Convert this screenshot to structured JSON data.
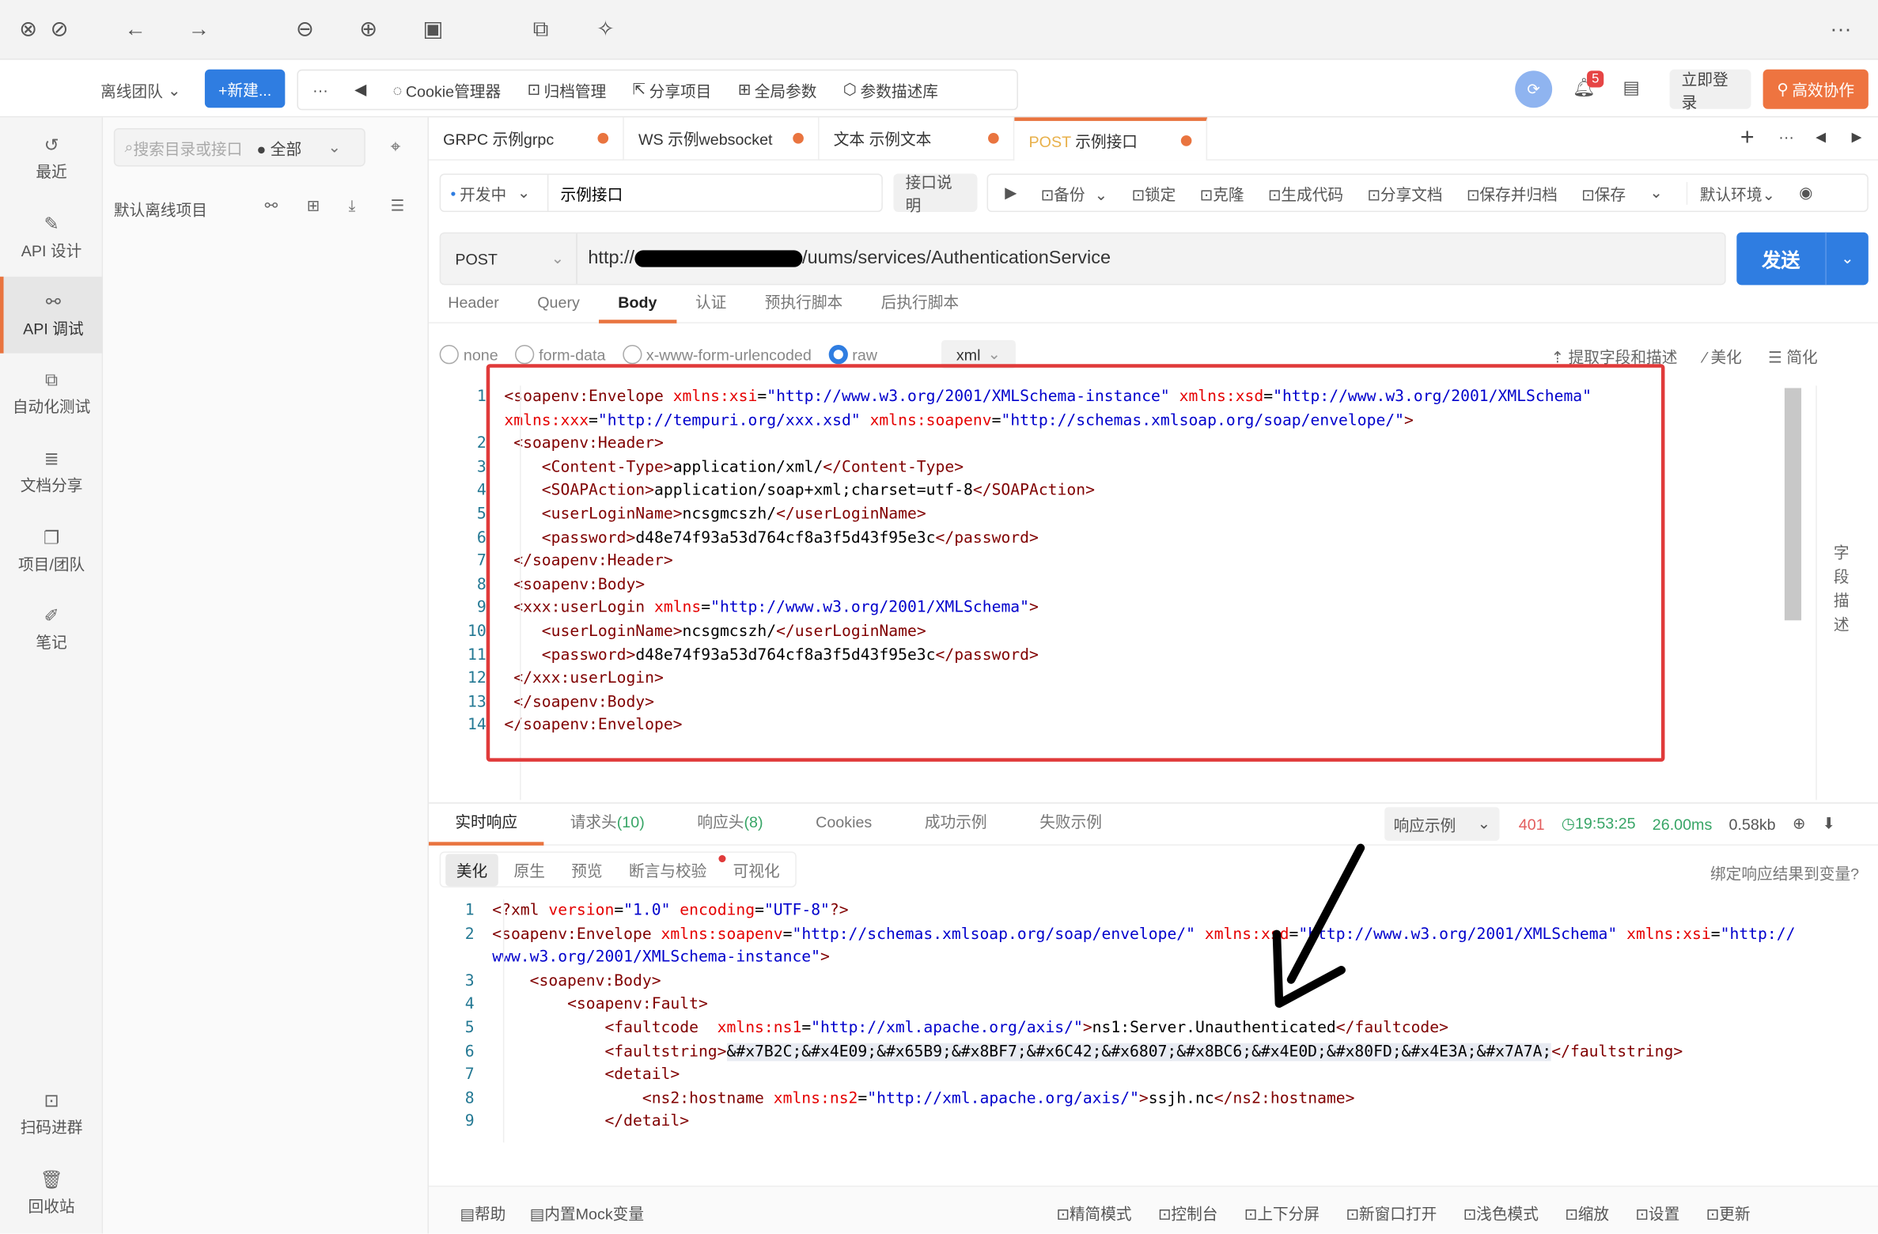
{
  "titlebar": {
    "icons": [
      "close-icon",
      "minimize-icon",
      "back-icon",
      "forward-icon",
      "zoom-out-icon",
      "zoom-in-icon",
      "fit-icon",
      "rotate-icon",
      "magic-icon",
      "more-icon"
    ]
  },
  "topbar": {
    "team": "离线团队",
    "new_btn": "+新建...",
    "more": "···",
    "tools": [
      "Cookie管理器",
      "归档管理",
      "分享项目",
      "全局参数",
      "参数描述库"
    ],
    "badge": "5",
    "login": "立即登录",
    "collab": "高效协作"
  },
  "leftnav": {
    "items": [
      "最近",
      "API 设计",
      "API 调试",
      "自动化测试",
      "文档分享",
      "项目/团队",
      "笔记"
    ],
    "active": 2,
    "bottom": [
      "扫码进群",
      "回收站"
    ]
  },
  "tree": {
    "search_placeholder": "搜索目录或接口",
    "filter": "全部",
    "project": "默认离线项目"
  },
  "tabs": [
    {
      "method": "GRPC",
      "name": "示例grpc"
    },
    {
      "method": "WS",
      "name": "示例websocket"
    },
    {
      "method": "文本",
      "name": "示例文本"
    },
    {
      "method": "POST",
      "name": "示例接口",
      "active": true
    }
  ],
  "request": {
    "status": "开发中",
    "name": "示例接口",
    "doc_btn": "接口说明",
    "actions": [
      "备份",
      "锁定",
      "克隆",
      "生成代码",
      "分享文档",
      "保存并归档",
      "保存"
    ],
    "env": "默认环境",
    "method": "POST",
    "url_prefix": "http://",
    "url_suffix": "/uums/services/AuthenticationService",
    "send": "发送"
  },
  "req_tabs": [
    "Header",
    "Query",
    "Body",
    "认证",
    "预执行脚本",
    "后执行脚本"
  ],
  "body_modes": [
    "none",
    "form-data",
    "x-www-form-urlencoded",
    "raw"
  ],
  "body_format": "xml",
  "body_tools": [
    "提取字段和描述",
    "美化",
    "简化"
  ],
  "side_label": "字段描述",
  "request_code": [
    {
      "n": "1",
      "t": [
        [
          "tag",
          "<soapenv:Envelope "
        ],
        [
          "attr",
          "xmlns:xsi"
        ],
        [
          "txt",
          "="
        ],
        [
          "val",
          "\"http://www.w3.org/2001/XMLSchema-instance\""
        ],
        [
          "txt",
          " "
        ],
        [
          "attr",
          "xmlns:xsd"
        ],
        [
          "txt",
          "="
        ],
        [
          "val",
          "\"http://www.w3.org/2001/XMLSchema\""
        ]
      ]
    },
    {
      "n": "",
      "t": [
        [
          "attr",
          "xmlns:xxx"
        ],
        [
          "txt",
          "="
        ],
        [
          "val",
          "\"http://tempuri.org/xxx.xsd\""
        ],
        [
          "txt",
          " "
        ],
        [
          "attr",
          "xmlns:soapenv"
        ],
        [
          "txt",
          "="
        ],
        [
          "val",
          "\"http://schemas.xmlsoap.org/soap/envelope/\""
        ],
        [
          "tag",
          ">"
        ]
      ]
    },
    {
      "n": "2",
      "t": [
        [
          "txt",
          " "
        ],
        [
          "tag",
          "<soapenv:Header>"
        ]
      ]
    },
    {
      "n": "3",
      "t": [
        [
          "txt",
          "    "
        ],
        [
          "tag",
          "<Content-Type>"
        ],
        [
          "txt",
          "application/xml/"
        ],
        [
          "tag",
          "</Content-Type>"
        ]
      ]
    },
    {
      "n": "4",
      "t": [
        [
          "txt",
          "    "
        ],
        [
          "tag",
          "<SOAPAction>"
        ],
        [
          "txt",
          "application/soap+xml;charset=utf-8"
        ],
        [
          "tag",
          "</SOAPAction>"
        ]
      ]
    },
    {
      "n": "5",
      "t": [
        [
          "txt",
          "    "
        ],
        [
          "tag",
          "<userLoginName>"
        ],
        [
          "txt",
          "ncsgmcszh/"
        ],
        [
          "tag",
          "</userLoginName>"
        ]
      ]
    },
    {
      "n": "6",
      "t": [
        [
          "txt",
          "    "
        ],
        [
          "tag",
          "<password>"
        ],
        [
          "txt",
          "d48e74f93a53d764cf8a3f5d43f95e3c"
        ],
        [
          "tag",
          "</password>"
        ]
      ]
    },
    {
      "n": "7",
      "t": [
        [
          "txt",
          " "
        ],
        [
          "tag",
          "</soapenv:Header>"
        ]
      ]
    },
    {
      "n": "8",
      "t": [
        [
          "txt",
          " "
        ],
        [
          "tag",
          "<soapenv:Body>"
        ]
      ]
    },
    {
      "n": "9",
      "t": [
        [
          "txt",
          " "
        ],
        [
          "tag",
          "<xxx:userLogin "
        ],
        [
          "attr",
          "xmlns"
        ],
        [
          "txt",
          "="
        ],
        [
          "val",
          "\"http://www.w3.org/2001/XMLSchema\""
        ],
        [
          "tag",
          ">"
        ]
      ]
    },
    {
      "n": "10",
      "t": [
        [
          "txt",
          "    "
        ],
        [
          "tag",
          "<userLoginName>"
        ],
        [
          "txt",
          "ncsgmcszh/"
        ],
        [
          "tag",
          "</userLoginName>"
        ]
      ]
    },
    {
      "n": "11",
      "t": [
        [
          "txt",
          "    "
        ],
        [
          "tag",
          "<password>"
        ],
        [
          "txt",
          "d48e74f93a53d764cf8a3f5d43f95e3c"
        ],
        [
          "tag",
          "</password>"
        ]
      ]
    },
    {
      "n": "12",
      "t": [
        [
          "txt",
          " "
        ],
        [
          "tag",
          "</xxx:userLogin>"
        ]
      ]
    },
    {
      "n": "13",
      "t": [
        [
          "txt",
          " "
        ],
        [
          "tag",
          "</soapenv:Body>"
        ]
      ]
    },
    {
      "n": "14",
      "t": [
        [
          "tag",
          "</soapenv:Envelope>"
        ]
      ]
    }
  ],
  "resp_tabs": [
    "实时响应",
    "请求头",
    "响应头",
    "Cookies",
    "成功示例",
    "失败示例"
  ],
  "resp_counts": {
    "req_headers": "(10)",
    "resp_headers": "(8)"
  },
  "resp_meta": {
    "example": "响应示例",
    "status": "401",
    "time": "19:53:25",
    "duration": "26.00ms",
    "size": "0.58kb"
  },
  "resp_views": [
    "美化",
    "原生",
    "预览",
    "断言与校验",
    "可视化"
  ],
  "bind_var": "绑定响应结果到变量?",
  "response_code": [
    {
      "n": "1",
      "t": [
        [
          "pi",
          "<?xml "
        ],
        [
          "attr",
          "version"
        ],
        [
          "txt",
          "="
        ],
        [
          "val",
          "\"1.0\""
        ],
        [
          "txt",
          " "
        ],
        [
          "attr",
          "encoding"
        ],
        [
          "txt",
          "="
        ],
        [
          "val",
          "\"UTF-8\""
        ],
        [
          "pi",
          "?>"
        ]
      ]
    },
    {
      "n": "2",
      "t": [
        [
          "tag",
          "<soapenv:Envelope "
        ],
        [
          "attr",
          "xmlns:soapenv"
        ],
        [
          "txt",
          "="
        ],
        [
          "val",
          "\"http://schemas.xmlsoap.org/soap/envelope/\""
        ],
        [
          "txt",
          " "
        ],
        [
          "attr",
          "xmlns:xsd"
        ],
        [
          "txt",
          "="
        ],
        [
          "val",
          "\"http://www.w3.org/2001/XMLSchema\""
        ],
        [
          "txt",
          " "
        ],
        [
          "attr",
          "xmlns:xsi"
        ],
        [
          "txt",
          "="
        ],
        [
          "val",
          "\"http://"
        ]
      ]
    },
    {
      "n": "",
      "t": [
        [
          "val",
          "www.w3.org/2001/XMLSchema-instance\""
        ],
        [
          "tag",
          ">"
        ]
      ]
    },
    {
      "n": "3",
      "t": [
        [
          "txt",
          "    "
        ],
        [
          "tag",
          "<soapenv:Body>"
        ]
      ]
    },
    {
      "n": "4",
      "t": [
        [
          "txt",
          "        "
        ],
        [
          "tag",
          "<soapenv:Fault>"
        ]
      ]
    },
    {
      "n": "5",
      "t": [
        [
          "txt",
          "            "
        ],
        [
          "tag",
          "<faultcode  "
        ],
        [
          "attr",
          "xmlns:ns1"
        ],
        [
          "txt",
          "="
        ],
        [
          "val",
          "\"http://xml.apache.org/axis/\""
        ],
        [
          "tag",
          ">"
        ],
        [
          "txt",
          "ns1:Server.Unauthenticated"
        ],
        [
          "tag",
          "</faultcode>"
        ]
      ]
    },
    {
      "n": "6",
      "t": [
        [
          "txt",
          "            "
        ],
        [
          "tag",
          "<faultstring>"
        ],
        [
          "txt",
          "&#x7B2C;&#x4E09;&#x65B9;&#x8BF7;&#x6C42;&#x6807;&#x8BC6;&#x4E0D;&#x80FD;&#x4E3A;&#x7A7A;"
        ],
        [
          "tag",
          "</faultstring>"
        ]
      ]
    },
    {
      "n": "7",
      "t": [
        [
          "txt",
          "            "
        ],
        [
          "tag",
          "<detail>"
        ]
      ]
    },
    {
      "n": "8",
      "t": [
        [
          "txt",
          "                "
        ],
        [
          "tag",
          "<ns2:hostname "
        ],
        [
          "attr",
          "xmlns:ns2"
        ],
        [
          "txt",
          "="
        ],
        [
          "val",
          "\"http://xml.apache.org/axis/\""
        ],
        [
          "tag",
          ">"
        ],
        [
          "txt",
          "ssjh.nc"
        ],
        [
          "tag",
          "</ns2:hostname>"
        ]
      ]
    },
    {
      "n": "9",
      "t": [
        [
          "txt",
          "            "
        ],
        [
          "tag",
          "</detail>"
        ]
      ]
    }
  ],
  "footer": {
    "left": [
      "帮助",
      "内置Mock变量"
    ],
    "right": [
      "精简模式",
      "控制台",
      "上下分屏",
      "新窗口打开",
      "浅色模式",
      "缩放",
      "设置",
      "更新"
    ]
  },
  "colors": {
    "accent": "#e9743f",
    "primary": "#2f7de1",
    "highlight": "#e03a3a"
  }
}
